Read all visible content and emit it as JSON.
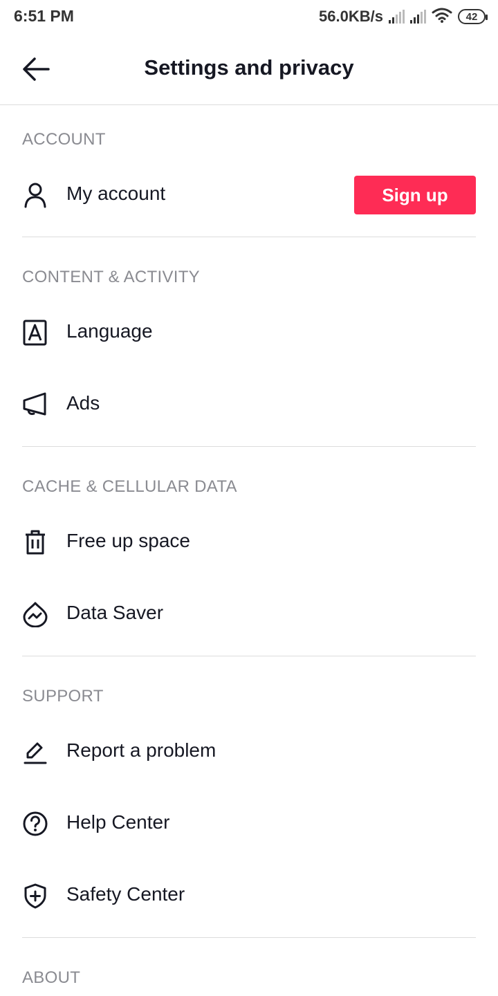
{
  "status": {
    "time": "6:51 PM",
    "net_speed": "56.0KB/s",
    "battery": "42"
  },
  "header": {
    "title": "Settings and privacy"
  },
  "sections": {
    "account": {
      "title": "ACCOUNT",
      "items": [
        {
          "label": "My account",
          "icon": "person-icon",
          "button": "Sign up"
        }
      ]
    },
    "content_activity": {
      "title": "CONTENT & ACTIVITY",
      "items": [
        {
          "label": "Language",
          "icon": "language-icon"
        },
        {
          "label": "Ads",
          "icon": "megaphone-icon"
        }
      ]
    },
    "cache": {
      "title": "CACHE & CELLULAR DATA",
      "items": [
        {
          "label": "Free up space",
          "icon": "trash-icon"
        },
        {
          "label": "Data Saver",
          "icon": "data-saver-icon"
        }
      ]
    },
    "support": {
      "title": "SUPPORT",
      "items": [
        {
          "label": "Report a problem",
          "icon": "pencil-icon"
        },
        {
          "label": "Help Center",
          "icon": "help-icon"
        },
        {
          "label": "Safety Center",
          "icon": "shield-icon"
        }
      ]
    },
    "about": {
      "title": "ABOUT"
    }
  },
  "colors": {
    "accent": "#fe2c55",
    "section_title": "#8a8b91",
    "text": "#161823",
    "divider": "#dcdcdc"
  }
}
